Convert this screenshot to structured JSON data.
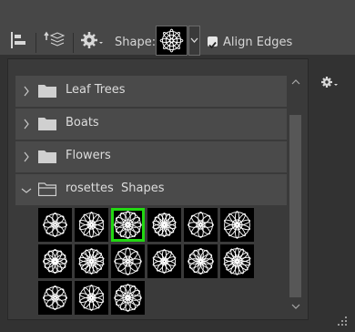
{
  "toolbar": {
    "shape_label": "Shape:",
    "align_edges_label": "Align Edges",
    "align_edges_checked": true
  },
  "panel": {
    "folders": [
      {
        "label": "Leaf Trees",
        "expanded": false
      },
      {
        "label": "Boats",
        "expanded": false
      },
      {
        "label": "Flowers",
        "expanded": false
      },
      {
        "label": "rosettes  Shapes",
        "expanded": true
      }
    ],
    "shape_count": 15,
    "selected_index": 2
  },
  "colors": {
    "selection": "#22d811",
    "toolbar": "#474747",
    "panel": "#3a3a3a"
  }
}
